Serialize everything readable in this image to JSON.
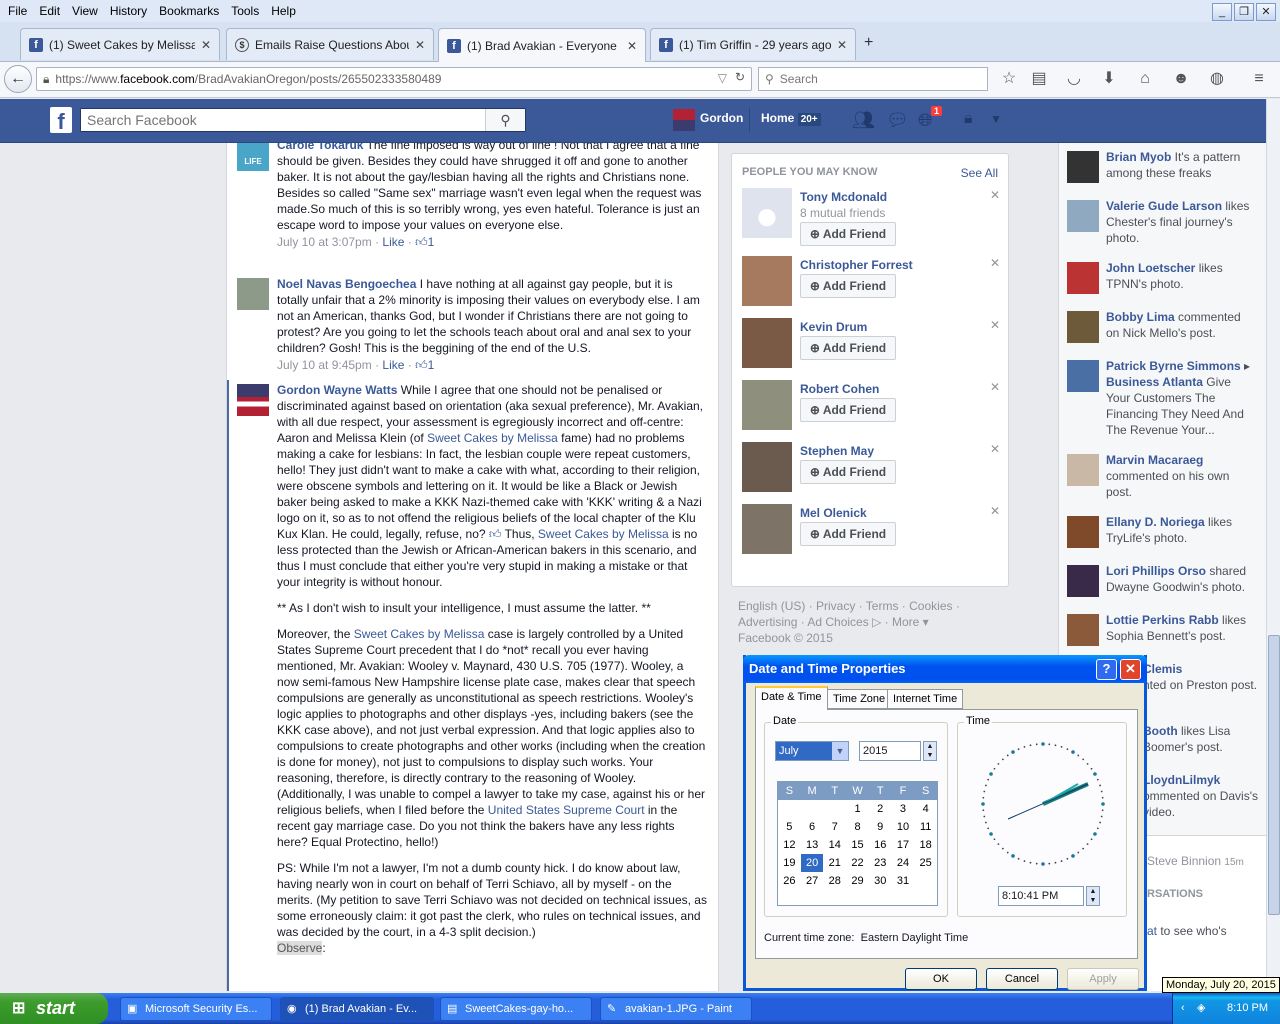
{
  "browser": {
    "menu": [
      "File",
      "Edit",
      "View",
      "History",
      "Bookmarks",
      "Tools",
      "Help"
    ],
    "tabs": [
      {
        "title": "(1) Sweet Cakes by Melissa",
        "icon": "facebook-icon"
      },
      {
        "title": "Emails Raise Questions About...",
        "icon": "dollar-icon"
      },
      {
        "title": "(1) Brad Avakian - Everyone ...",
        "icon": "facebook-icon"
      },
      {
        "title": "(1) Tim Griffin - 29 years ago ...",
        "icon": "facebook-icon"
      }
    ],
    "url_prefix": "https://www.",
    "url_domain": "facebook.com",
    "url_path": "/BradAvakianOregon/posts/265502333580489",
    "search_placeholder": "Search"
  },
  "fb": {
    "logo": "f",
    "search_placeholder": "Search Facebook",
    "user": "Gordon",
    "home": "Home",
    "home_badge": "20+",
    "notif_badge": "1"
  },
  "comments": [
    {
      "name": "Carole Tokaruk",
      "avatar_text": "LIFE",
      "text": " The fine imposed is way out of line ! Not that I agree that a fine should be given. Besides they could have shrugged it off and gone to another baker. It is not about the gay/lesbian having all the rights and Christians none. Besides so called \"Same sex\" marriage wasn't even legal when the request was made.So much of this is so terribly wrong, yes even hateful. Tolerance is just an escape word to impose your values on everyone else.",
      "time": "July 10 at 3:07pm",
      "like": "Like",
      "count": "1"
    },
    {
      "name": "Noel Navas Bengoechea",
      "text": " I have nothing at all against gay people, but it is totally unfair that a 2% minority is imposing their values on everybody else. I am not an American, thanks God, but I wonder if Christians there are not going to protest? Are you going to let the schools teach about oral and anal sex to your children? Gosh! This is the beggining of the end of the U.S.",
      "time": "July 10 at 9:45pm",
      "like": "Like",
      "count": "1"
    }
  ],
  "gordon": {
    "name": "Gordon Wayne Watts",
    "p1a": " While I agree that one should not be penalised or discriminated against based on orientation (aka sexual preference), Mr. Avakian, with all due respect, your assessment is egregiously incorrect and off-centre: Aaron and Melissa Klein (of ",
    "link1": "Sweet Cakes by Melissa",
    "p1b": " fame) had no problems making a cake for lesbians: In fact, the lesbian couple were repeat customers, hello! They just didn't want to make a cake with what, according to their religion, were obscene symbols and lettering on it. It would be like a Black or Jewish baker being asked to make a KKK Nazi-themed cake with 'KKK' writing & a Nazi logo on it, so as to not offend the religious beliefs of the local chapter of the Klu Kux Klan. He could, legally, refuse, no? ",
    "p1c": " Thus, ",
    "link2": "Sweet Cakes by Melissa",
    "p1d": " is no less protected than the Jewish or African-American bakers in this scenario, and thus I must conclude that either you're very stupid in making a mistake or that your integrity is without honour.",
    "p2": "** As I don't wish to insult your intelligence, I must assume the latter. **",
    "p3a": "Moreover, the ",
    "link3": "Sweet Cakes by Melissa",
    "p3b": " case is largely controlled by a United States Supreme Court precedent that I do *not* recall you ever having mentioned, Mr. Avakian: Wooley v. Maynard, 430 U.S. 705 (1977). Wooley, a now semi-famous New Hampshire license plate case, makes clear that speech compulsions are generally as unconstitutional as speech restrictions. Wooley's logic applies to photographs and other displays -yes, including bakers (see the KKK case above), and not just verbal expression. And that logic applies also to compulsions to create photographs and other works (including when the creation is done for money), not just to compulsions to display such works. Your reasoning, therefore, is directly contrary to the reasoning of Wooley. (Additionally, I was unable to compel a lawyer to take my case, against his or her religious beliefs, when I filed before the ",
    "link4": "United States Supreme Court",
    "p3c": " in the recent gay marriage case. Do you not think the bakers have any less rights here? Equal Protectino, hello!)",
    "p4": "PS: While I'm not a lawyer, I'm not a dumb county hick. I do know about law, having nearly won in court on behalf of Terri Schiavo, all by myself - on the merits. (My petition to save Terri Schiavo was not decided on technical issues, as some erroneously claim: it got past the clerk, who rules on technical issues, and was decided by the court, in a 4-3 split decision.)",
    "p5a": "Observe",
    "p5b": ":"
  },
  "pymk": {
    "title": "PEOPLE YOU MAY KNOW",
    "see_all": "See All",
    "add_label": "Add Friend",
    "people": [
      {
        "name": "Tony Mcdonald",
        "mutual": "8 mutual friends"
      },
      {
        "name": "Christopher Forrest",
        "mutual": ""
      },
      {
        "name": "Kevin Drum",
        "mutual": ""
      },
      {
        "name": "Robert Cohen",
        "mutual": ""
      },
      {
        "name": "Stephen May",
        "mutual": ""
      },
      {
        "name": "Mel Olenick",
        "mutual": ""
      }
    ]
  },
  "footer": {
    "line1": "English (US) · Privacy · Terms · Cookies ·",
    "line2": "Advertising · Ad Choices",
    "more": "· More ▾",
    "line3": "Facebook © 2015"
  },
  "ticker": [
    {
      "name": "Brian Myob",
      "text": " It's a pattern among these freaks"
    },
    {
      "name": "Valerie Gude Larson",
      "text": " likes Chester's final journey's photo."
    },
    {
      "name": "John Loetscher",
      "text": " likes TPNN's photo."
    },
    {
      "name": "Bobby Lima",
      "text": " commented on Nick Mello's post."
    },
    {
      "name": "Patrick Byrne Simmons",
      "text": " ▸ ",
      "name2": "Business Atlanta",
      "text2": " Give Your Customers The Financing They Need And The Revenue Your..."
    },
    {
      "name": "Marvin Macaraeg",
      "text": " commented on his own post."
    },
    {
      "name": "Ellany D. Noriega",
      "text": " likes TryLife's photo."
    },
    {
      "name": "Lori Phillips Orso",
      "text": " shared Dwayne Goodwin's photo."
    },
    {
      "name": "Lottie Perkins Rabb",
      "text": " likes Sophia Bennett's post."
    }
  ],
  "ticker_partial": [
    {
      "name": "Clemis",
      "text": "nted on Preston post."
    },
    {
      "name": "Booth",
      "text": " likes Lisa Boomer's post."
    },
    {
      "name": "LloydnLilmyk",
      "text": "ommented on Davis's video."
    }
  ],
  "chat_peek": {
    "name": "Steve Binnion",
    "time": "15m",
    "section": "RSATIONS",
    "hint_link": "at",
    "hint": " to see who's"
  },
  "dialog": {
    "title": "Date and Time Properties",
    "help": "?",
    "close": "✕",
    "tabs": [
      "Date & Time",
      "Time Zone",
      "Internet Time"
    ],
    "date_label": "Date",
    "time_label": "Time",
    "month": "July",
    "year": "2015",
    "weekdays": [
      "S",
      "M",
      "T",
      "W",
      "T",
      "F",
      "S"
    ],
    "weeks": [
      [
        "",
        "",
        "",
        "1",
        "2",
        "3",
        "4"
      ],
      [
        "5",
        "6",
        "7",
        "8",
        "9",
        "10",
        "11"
      ],
      [
        "12",
        "13",
        "14",
        "15",
        "16",
        "17",
        "18"
      ],
      [
        "19",
        "20",
        "21",
        "22",
        "23",
        "24",
        "25"
      ],
      [
        "26",
        "27",
        "28",
        "29",
        "30",
        "31",
        ""
      ]
    ],
    "selected_day": "20",
    "time": "8:10:41 PM",
    "tz_label": "Current time zone:",
    "tz": "Eastern Daylight Time",
    "ok": "OK",
    "cancel": "Cancel",
    "apply": "Apply"
  },
  "taskbar": {
    "start": "start",
    "tasks": [
      "Microsoft Security Es...",
      "(1) Brad Avakian - Ev...",
      "SweetCakes-gay-ho...",
      "avakian-1.JPG - Paint"
    ],
    "clock": "8:10 PM",
    "tooltip": "Monday, July 20, 2015"
  }
}
